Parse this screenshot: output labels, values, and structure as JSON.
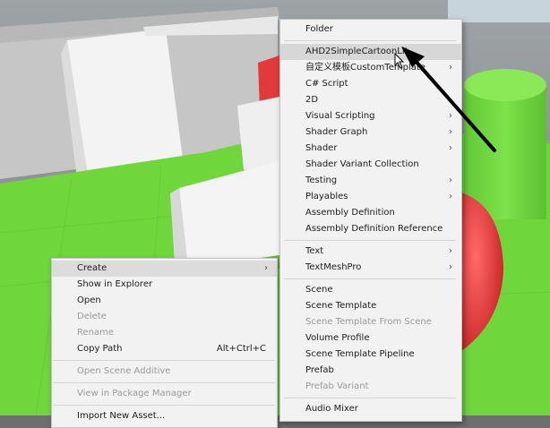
{
  "context_menu": {
    "items": [
      {
        "label": "Create",
        "submenu": true,
        "state": "hover"
      },
      {
        "label": "Show in Explorer"
      },
      {
        "label": "Open"
      },
      {
        "label": "Delete",
        "state": "disabled"
      },
      {
        "label": "Rename",
        "state": "disabled"
      },
      {
        "label": "Copy Path",
        "shortcut": "Alt+Ctrl+C"
      },
      {
        "separator": true
      },
      {
        "label": "Open Scene Additive",
        "state": "disabled"
      },
      {
        "separator": true
      },
      {
        "label": "View in Package Manager",
        "state": "disabled"
      },
      {
        "separator": true
      },
      {
        "label": "Import New Asset..."
      }
    ]
  },
  "create_submenu": {
    "items": [
      {
        "label": "Folder"
      },
      {
        "separator": true
      },
      {
        "label": "AHD2SimpleCartoonLit",
        "state": "highlight"
      },
      {
        "label": "自定义模板CustomTemplate",
        "submenu": true
      },
      {
        "label": "C# Script"
      },
      {
        "label": "2D",
        "submenu": true
      },
      {
        "label": "Visual Scripting",
        "submenu": true
      },
      {
        "label": "Shader Graph",
        "submenu": true
      },
      {
        "label": "Shader",
        "submenu": true
      },
      {
        "label": "Shader Variant Collection"
      },
      {
        "label": "Testing",
        "submenu": true
      },
      {
        "label": "Playables",
        "submenu": true
      },
      {
        "label": "Assembly Definition"
      },
      {
        "label": "Assembly Definition Reference"
      },
      {
        "separator": true
      },
      {
        "label": "Text",
        "submenu": true
      },
      {
        "label": "TextMeshPro",
        "submenu": true
      },
      {
        "separator": true
      },
      {
        "label": "Scene"
      },
      {
        "label": "Scene Template"
      },
      {
        "label": "Scene Template From Scene",
        "state": "disabled"
      },
      {
        "label": "Volume Profile"
      },
      {
        "label": "Scene Template Pipeline"
      },
      {
        "label": "Prefab"
      },
      {
        "label": "Prefab Variant",
        "state": "disabled"
      },
      {
        "separator": true
      },
      {
        "label": "Audio Mixer"
      }
    ]
  },
  "submenu_arrow_glyph": "›",
  "icons": {
    "mouse_cursor": "mouse-pointer-icon",
    "annotation": "annotation-arrow-icon"
  },
  "colors": {
    "menu_bg": "#f2f2f2",
    "hover_bg": "#dcdcdc",
    "disabled_text": "#9a9a9a",
    "ground_green": "#6fd63c",
    "red_object": "#e23a3a",
    "sky": "#8a8a8a"
  }
}
